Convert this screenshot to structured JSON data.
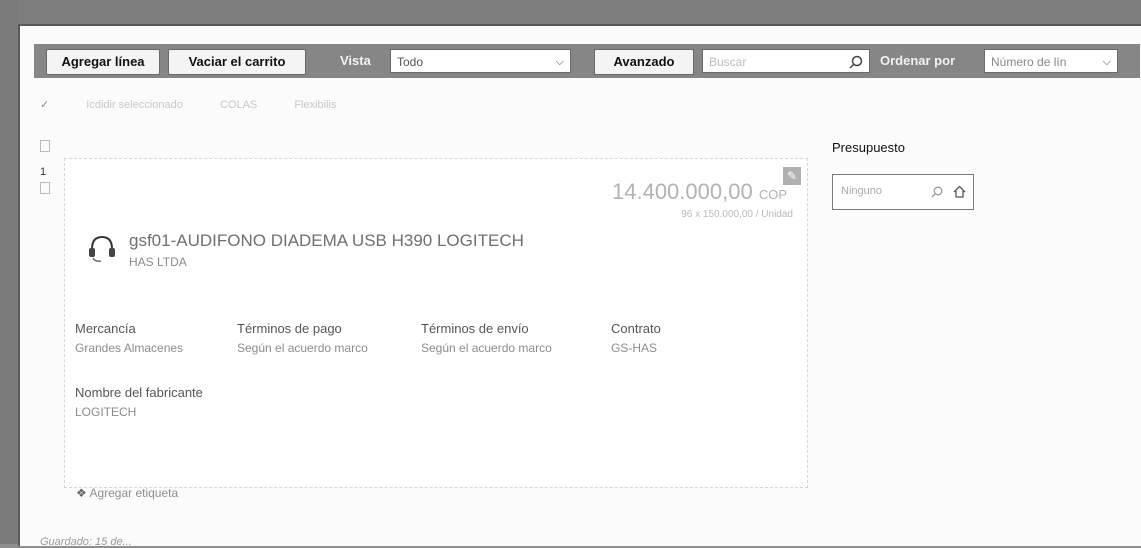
{
  "toolbar": {
    "add_line": "Agregar línea",
    "empty_cart": "Vaciar el carrito",
    "view_label": "Vista",
    "view_value": "Todo",
    "advanced": "Avanzado",
    "search_placeholder": "Buscar",
    "sort_label": "Ordenar por",
    "sort_value": "Número de lín"
  },
  "subtoolbar": {
    "items": [
      "Icdidir seleccionado",
      "COLAS",
      "Flexibilis"
    ]
  },
  "left_rail": {
    "line_number": "1"
  },
  "item": {
    "price": "14.400.000,00",
    "price_currency": "COP",
    "unit_price": "96 x 150.000,00 / Unidad",
    "title": "gsf01-AUDIFONO DIADEMA USB H390 LOGITECH",
    "supplier": "HAS LTDA",
    "attributes": [
      {
        "label": "Mercancía",
        "value": "Grandes Almacenes"
      },
      {
        "label": "Términos de pago",
        "value": "Según el acuerdo marco"
      },
      {
        "label": "Términos de envío",
        "value": "Según el acuerdo marco"
      },
      {
        "label": "Contrato",
        "value": "GS-HAS"
      }
    ],
    "manufacturer_label": "Nombre del fabricante",
    "manufacturer_value": "LOGITECH",
    "add_tag": "Agregar etiqueta"
  },
  "budget": {
    "title": "Presupuesto",
    "value": "Ninguno"
  },
  "footer": {
    "text": "Guardado: 15 de..."
  },
  "colors": {
    "toolbar_bg": "#868686",
    "page_bg": "#fbfbfb"
  },
  "icons": [
    "search-icon",
    "chevron-down-icon",
    "edit-icon",
    "headset-icon",
    "house-icon",
    "tag-icon"
  ]
}
